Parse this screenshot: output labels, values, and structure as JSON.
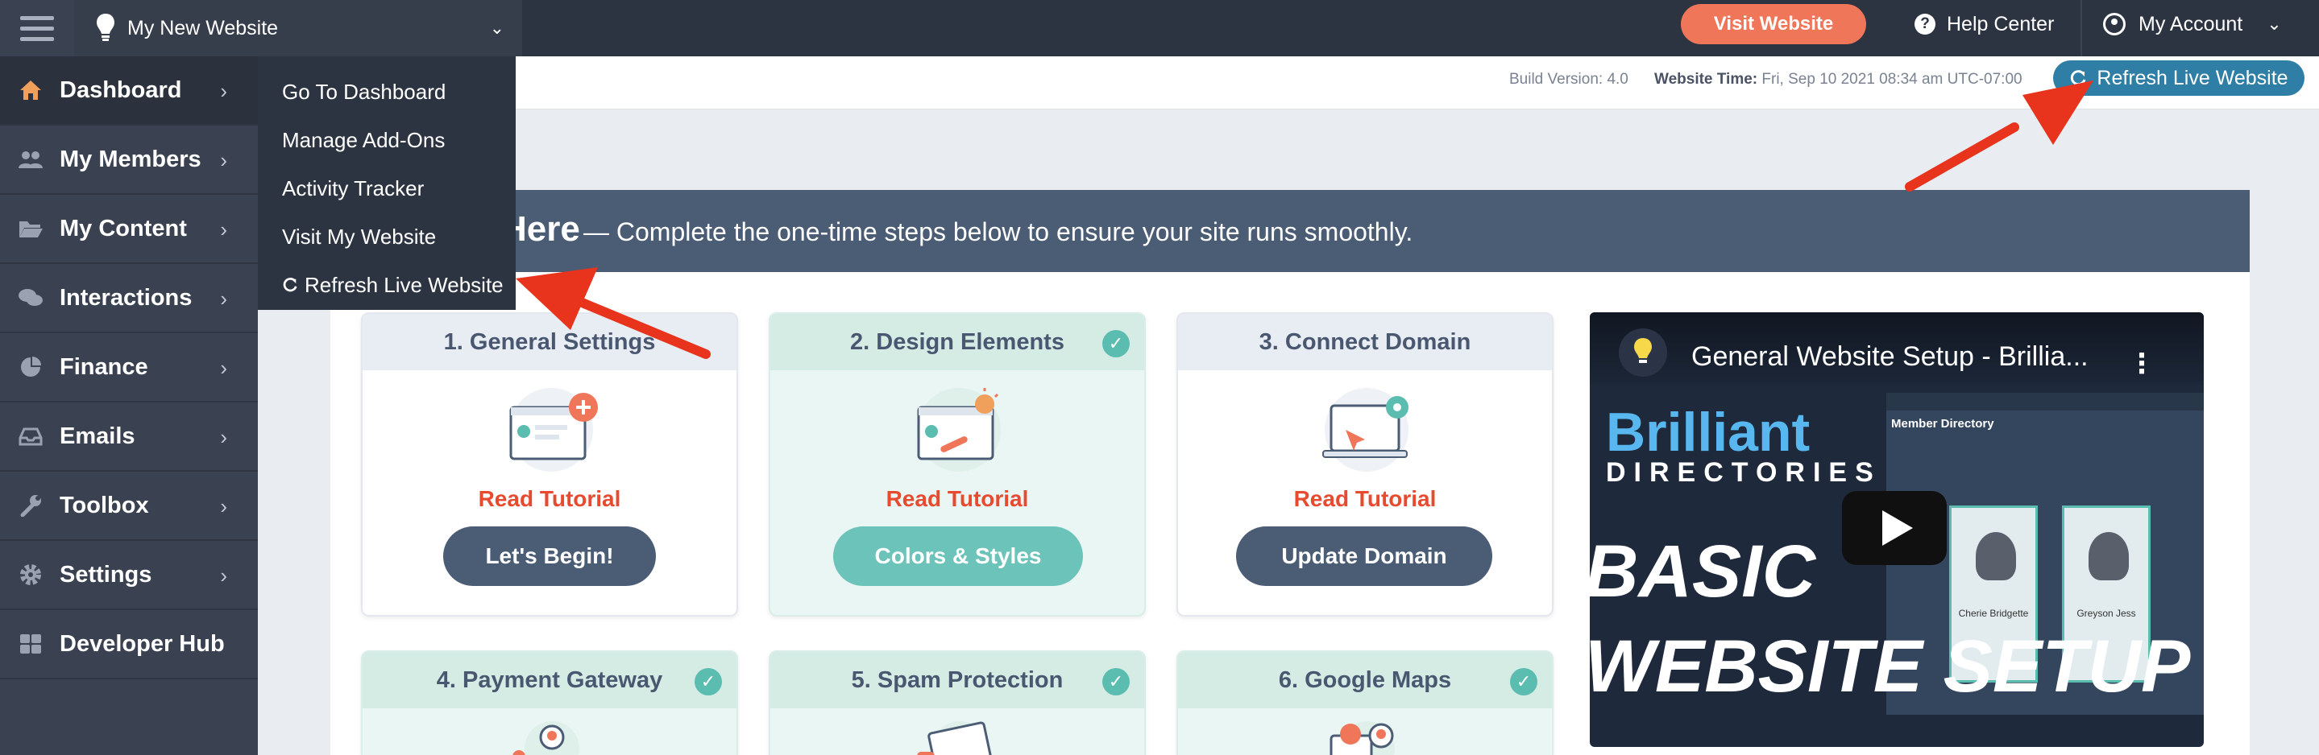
{
  "topbar": {
    "site_name": "My New Website",
    "visit_button": "Visit Website",
    "help_center": "Help Center",
    "my_account": "My Account"
  },
  "infobar": {
    "build_version": "Build Version: 4.0",
    "website_time_label": "Website Time:",
    "website_time_value": "Fri, Sep 10 2021 08:34 am UTC-07:00",
    "refresh_button": "Refresh Live Website"
  },
  "sidebar": {
    "items": [
      {
        "label": "Dashboard",
        "icon": "home-icon"
      },
      {
        "label": "My Members",
        "icon": "users-icon"
      },
      {
        "label": "My Content",
        "icon": "folder-icon"
      },
      {
        "label": "Interactions",
        "icon": "chat-icon"
      },
      {
        "label": "Finance",
        "icon": "pie-chart-icon"
      },
      {
        "label": "Emails",
        "icon": "inbox-icon"
      },
      {
        "label": "Toolbox",
        "icon": "wrench-icon"
      },
      {
        "label": "Settings",
        "icon": "gear-icon"
      },
      {
        "label": "Developer Hub",
        "icon": "grid-icon"
      }
    ]
  },
  "flyout": {
    "items": [
      "Go To Dashboard",
      "Manage Add-Ons",
      "Activity Tracker",
      "Visit My Website",
      "Refresh Live Website"
    ]
  },
  "banner": {
    "title": "Here",
    "text": "— Complete the one-time steps below to ensure your site runs smoothly."
  },
  "cards": [
    {
      "title": "1. General Settings",
      "done": false,
      "link": "Read Tutorial",
      "button": "Let's Begin!",
      "button_color": "#4b5c75"
    },
    {
      "title": "2. Design Elements",
      "done": true,
      "link": "Read Tutorial",
      "button": "Colors & Styles",
      "button_color": "#6cc3b9"
    },
    {
      "title": "3. Connect Domain",
      "done": false,
      "link": "Read Tutorial",
      "button": "Update Domain",
      "button_color": "#4b5c75"
    },
    {
      "title": "4. Payment Gateway",
      "done": true
    },
    {
      "title": "5. Spam Protection",
      "done": true
    },
    {
      "title": "6. Google Maps",
      "done": true
    }
  ],
  "video": {
    "title": "General Website Setup - Brillia...",
    "brand_line1": "Brilliant",
    "brand_line2": "DIRECTORIES",
    "headline1": "BASIC",
    "headline2": "WEBSITE SETUP",
    "inner_title": "Member Directory",
    "member1": "Cherie Bridgette",
    "member2": "Greyson Jess"
  },
  "colors": {
    "accent_orange": "#f0765a",
    "accent_blue": "#2e7ea5",
    "teal": "#5bbcb0",
    "sidebar": "#3a4150",
    "arrow_red": "#e8341c"
  }
}
